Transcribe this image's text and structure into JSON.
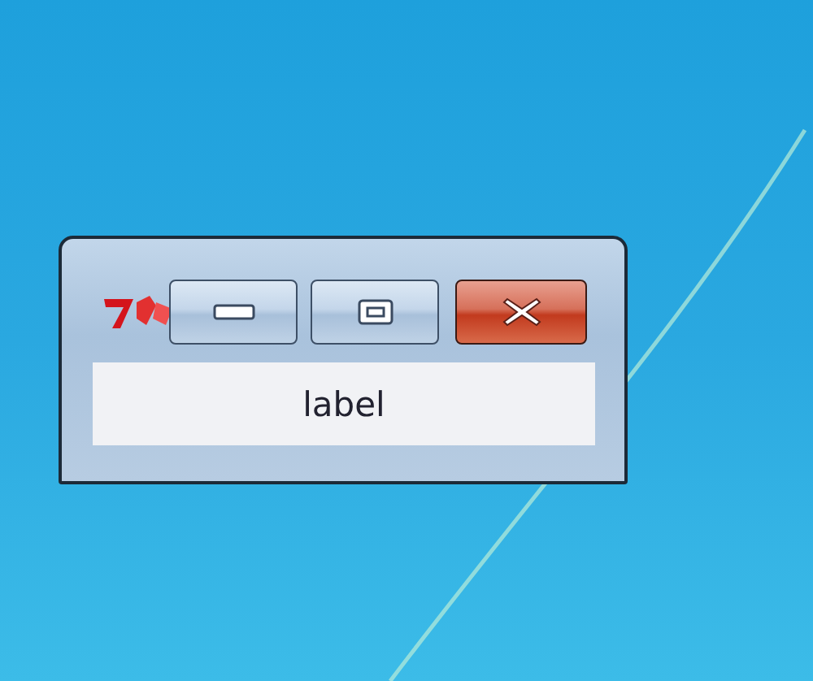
{
  "window": {
    "label": "label"
  }
}
